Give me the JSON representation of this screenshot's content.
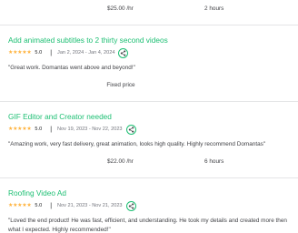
{
  "top_row": {
    "rate": "$25.00 /hr",
    "hours": "2 hours"
  },
  "items": [
    {
      "title": "Add animated subtitles to 2 thirty second videos",
      "stars": "★★★★★",
      "rating": "5.0",
      "dates": "Jan 2, 2024 - Jan 4, 2024",
      "review": "\"Great work. Domantas went above and beyond!\"",
      "price": "Fixed price"
    },
    {
      "title": "GIF Editor and Creator needed",
      "stars": "★★★★★",
      "rating": "5.0",
      "dates": "Nov 19, 2023 - Nov 22, 2023",
      "review": "\"Amazing work, very fast delivery, great animation, looks high quality. Highly recommend Domantas\"",
      "rate": "$22.00 /hr",
      "hours": "6 hours"
    },
    {
      "title": "Roofing Video Ad",
      "stars": "★★★★★",
      "rating": "5.0",
      "dates": "Nov 21, 2023 - Nov 21, 2023",
      "review": "\"Loved the end product! He was fast, efficient, and understanding. He took my details and created more then what I expected. Highly recommended!\""
    }
  ],
  "colors": {
    "accent": "#1dbf73",
    "star": "#ffb33e",
    "text": "#404145",
    "muted": "#74767e",
    "divider": "#e4e5e7"
  },
  "icons": {
    "share": "share-icon",
    "star": "star-icon"
  }
}
